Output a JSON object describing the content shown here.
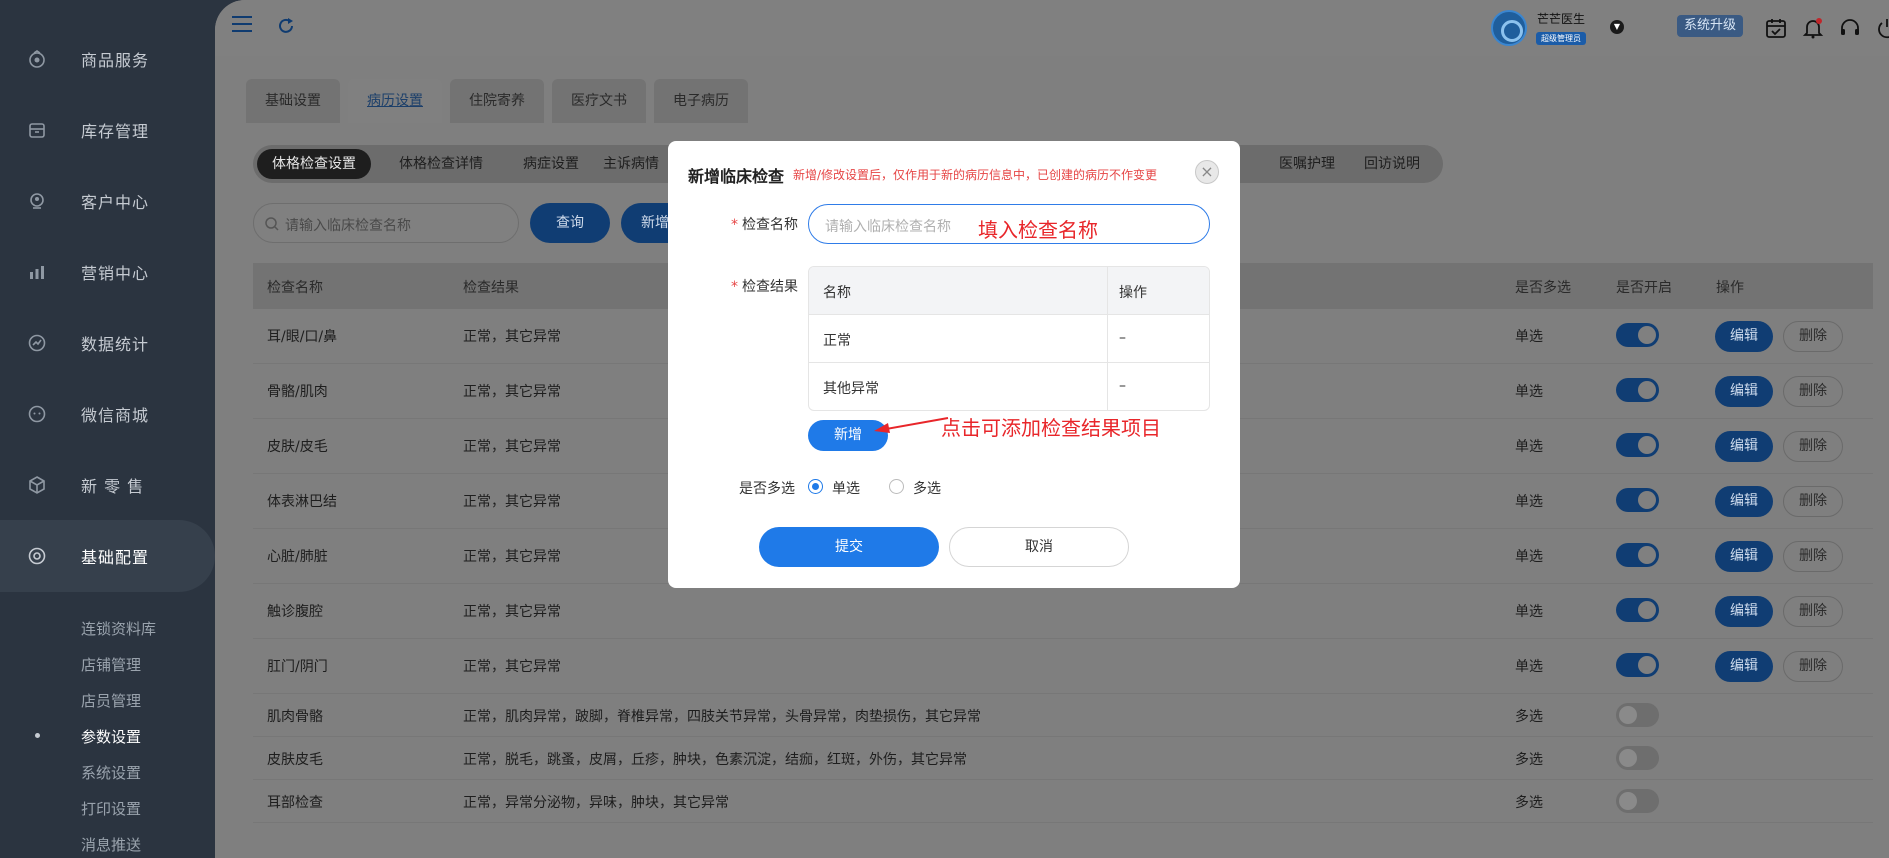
{
  "sidebar": {
    "items": [
      {
        "label": "商品服务",
        "icon": "goods-icon"
      },
      {
        "label": "库存管理",
        "icon": "inventory-icon"
      },
      {
        "label": "客户中心",
        "icon": "customer-icon"
      },
      {
        "label": "营销中心",
        "icon": "marketing-icon"
      },
      {
        "label": "数据统计",
        "icon": "statistics-icon"
      },
      {
        "label": "微信商城",
        "icon": "wechat-mall-icon"
      },
      {
        "label": "新 零 售",
        "icon": "retail-icon"
      },
      {
        "label": "基础配置",
        "icon": "settings-icon"
      }
    ],
    "sub_items": [
      "连锁资料库",
      "店铺管理",
      "店员管理",
      "参数设置",
      "系统设置",
      "打印设置",
      "消息推送"
    ]
  },
  "topbar": {
    "user_name": "芒芒医生",
    "user_role": "超级管理员",
    "upgrade_label": "系统升级"
  },
  "tabs": [
    "基础设置",
    "病历设置",
    "住院寄养",
    "医疗文书",
    "电子病历"
  ],
  "subtabs": [
    "体格检查设置",
    "体格检查详情",
    "病症设置",
    "主诉病情",
    "医嘱护理",
    "回访说明"
  ],
  "toolbar": {
    "search_placeholder": "请输入临床检查名称",
    "query_label": "查询",
    "add_label": "新增"
  },
  "table": {
    "headers": [
      "检查名称",
      "检查结果",
      "是否多选",
      "是否开启",
      "操作"
    ],
    "edit_label": "编辑",
    "delete_label": "删除",
    "rows": [
      {
        "name": "耳/眼/口/鼻",
        "result": "正常，其它异常",
        "multi": "单选",
        "enabled": true
      },
      {
        "name": "骨骼/肌肉",
        "result": "正常，其它异常",
        "multi": "单选",
        "enabled": true
      },
      {
        "name": "皮肤/皮毛",
        "result": "正常，其它异常",
        "multi": "单选",
        "enabled": true
      },
      {
        "name": "体表淋巴结",
        "result": "正常，其它异常",
        "multi": "单选",
        "enabled": true
      },
      {
        "name": "心脏/肺脏",
        "result": "正常，其它异常",
        "multi": "单选",
        "enabled": true
      },
      {
        "name": "触诊腹腔",
        "result": "正常，其它异常",
        "multi": "单选",
        "enabled": true
      },
      {
        "name": "肛门/阴门",
        "result": "正常，其它异常",
        "multi": "单选",
        "enabled": true
      },
      {
        "name": "肌肉骨骼",
        "result": "正常，肌肉异常，跛脚，脊椎异常，四肢关节异常，头骨异常，肉垫损伤，其它异常",
        "multi": "多选",
        "enabled": false
      },
      {
        "name": "皮肤皮毛",
        "result": "正常，脱毛，跳蚤，皮屑，丘疹，肿块，色素沉淀，结痂，红斑，外伤，其它异常",
        "multi": "多选",
        "enabled": false
      },
      {
        "name": "耳部检查",
        "result": "正常，异常分泌物，异味，肿块，其它异常",
        "multi": "多选",
        "enabled": false
      }
    ]
  },
  "modal": {
    "title": "新增临床检查",
    "note": "新增/修改设置后，仅作用于新的病历信息中，已创建的病历不作变更",
    "name_label": "检查名称",
    "name_placeholder": "请输入临床检查名称",
    "result_label": "检查结果",
    "result_headers": [
      "名称",
      "操作"
    ],
    "result_rows": [
      {
        "name": "正常",
        "op": "–"
      },
      {
        "name": "其他异常",
        "op": "–"
      }
    ],
    "add_result_label": "新增",
    "multi_label": "是否多选",
    "option_single": "单选",
    "option_multi": "多选",
    "submit_label": "提交",
    "cancel_label": "取消"
  },
  "annotations": {
    "name_hint": "填入检查名称",
    "add_hint": "点击可添加检查结果项目"
  },
  "colors": {
    "primary": "#1f7ae8",
    "annotation_red": "#e8262a",
    "sidebar_bg": "#2b3440"
  }
}
